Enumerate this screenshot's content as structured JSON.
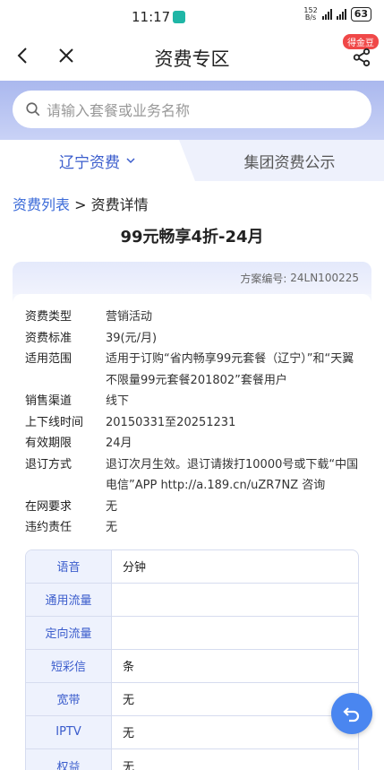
{
  "status": {
    "time": "11:17",
    "net_top": "152",
    "net_bottom": "B/s",
    "battery": "63"
  },
  "nav": {
    "title": "资费专区",
    "badge": "得金豆"
  },
  "search": {
    "placeholder": "请输入套餐或业务名称"
  },
  "tabs": {
    "left": "辽宁资费",
    "right": "集团资费公示"
  },
  "breadcrumb": {
    "parent": "资费列表",
    "sep": " > ",
    "current": "资费详情"
  },
  "plan": {
    "title": "99元畅享4折-24月",
    "code_label": "方案编号:",
    "code": "24LN100225",
    "rows": [
      {
        "k": "资费类型",
        "v": "营销活动"
      },
      {
        "k": "资费标准",
        "v": "39(元/月)"
      },
      {
        "k": "适用范围",
        "v": "适用于订购“省内畅享99元套餐（辽宁）”和“天翼不限量99元套餐201802”套餐用户"
      },
      {
        "k": "销售渠道",
        "v": "线下"
      },
      {
        "k": "上下线时间",
        "v": "20150331至20251231"
      },
      {
        "k": "有效期限",
        "v": "24月"
      },
      {
        "k": "退订方式",
        "v": "退订次月生效。退订请拨打10000号或下载“中国电信”APP http://a.189.cn/uZR7NZ 咨询"
      },
      {
        "k": "在网要求",
        "v": "无"
      },
      {
        "k": "违约责任",
        "v": "无"
      }
    ],
    "table": [
      {
        "k": "语音",
        "v": "分钟"
      },
      {
        "k": "通用流量",
        "v": ""
      },
      {
        "k": "定向流量",
        "v": ""
      },
      {
        "k": "短彩信",
        "v": "条"
      },
      {
        "k": "宽带",
        "v": "无"
      },
      {
        "k": "IPTV",
        "v": "无"
      },
      {
        "k": "权益",
        "v": "无"
      }
    ]
  }
}
